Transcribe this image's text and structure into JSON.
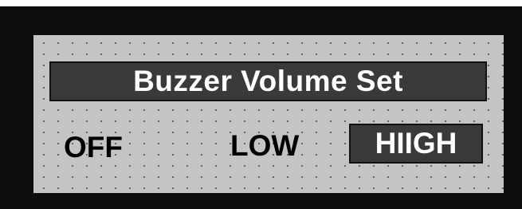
{
  "screen": {
    "title": "Buzzer Volume Set",
    "options": [
      {
        "label": "OFF",
        "selected": false
      },
      {
        "label": "LOW",
        "selected": false
      },
      {
        "label": "HIIGH",
        "selected": true
      }
    ]
  },
  "colors": {
    "frame": "#0d0d0d",
    "panel": "#c5c3c6",
    "highlight_bg": "#3a3a3a",
    "highlight_text": "#ffffff",
    "text": "#000000"
  }
}
